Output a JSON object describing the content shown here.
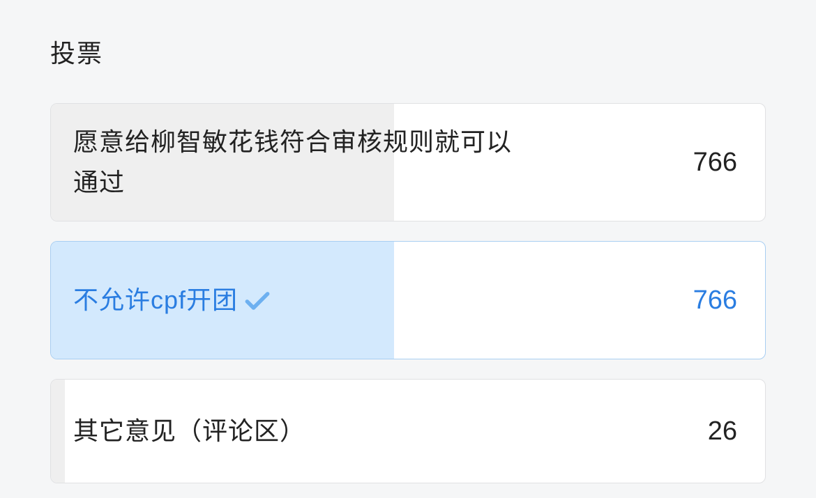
{
  "poll": {
    "title": "投票",
    "total_width_percent_base": 766,
    "options": [
      {
        "label": "愿意给柳智敏花钱符合审核规则就可以通过",
        "count": "766",
        "fill_percent": 48,
        "selected": false,
        "truncated": false
      },
      {
        "label": "不允许cpf开团",
        "count": "766",
        "fill_percent": 48,
        "selected": true,
        "truncated": false
      },
      {
        "label": "其它意见（评论区）",
        "count": "26",
        "fill_percent": 2,
        "selected": false,
        "truncated": true
      }
    ]
  }
}
